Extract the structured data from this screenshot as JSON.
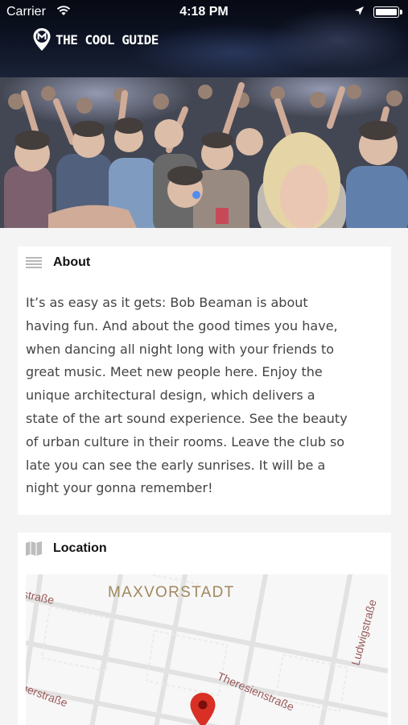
{
  "status_bar": {
    "carrier": "Carrier",
    "time": "4:18 PM",
    "wifi_icon": "wifi-icon",
    "location_icon": "location-arrow-icon",
    "battery_icon": "battery-icon"
  },
  "header": {
    "brand_name": "THE COOL GUIDE",
    "logo_icon": "map-pin-logo-icon"
  },
  "hero": {
    "image": "crowd-dancing-photo"
  },
  "about": {
    "icon": "menu-lines-icon",
    "title": "About",
    "lines": [
      "It’s as easy as it gets: Bob Beaman is about",
      "having fun. And about the good times you have,",
      "when dancing all night long with your friends to",
      "great music. Meet new people here. Enjoy the",
      "unique architectural design, which delivers a",
      "state of the art sound experience. See the beauty",
      "of urban culture in their rooms. Leave the club so",
      "late you can see the early sunrises. It will be a",
      "night your gonna remember!"
    ]
  },
  "location": {
    "icon": "map-icon",
    "title": "Location",
    "map": {
      "district": "MAXVORSTADT",
      "streets": [
        "straße",
        "Theresienstraße",
        "Ludwigstraße",
        "gerstraße"
      ],
      "pin_icon": "map-marker-icon"
    }
  },
  "colors": {
    "district_label": "#a08860",
    "street_label": "#9a5a5a",
    "pin": "#d93025",
    "card_bg": "#ffffff",
    "page_bg": "#f4f4f4"
  }
}
